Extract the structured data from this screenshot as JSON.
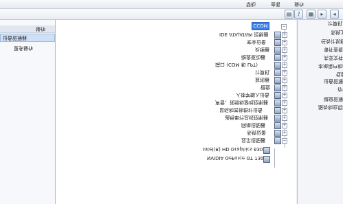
{
  "menu": [
    "帮助",
    "查看",
    "操作"
  ],
  "left_pane": {
    "header": "操作",
    "selected": "设备管理器",
    "sub": "更多操作"
  },
  "tree": {
    "root": "CCOM",
    "items": [
      {
        "label": "IDE ATA/ATAPI 控制器",
        "expanded": false
      },
      {
        "label": "安全设备",
        "expanded": false
      },
      {
        "label": "处理器",
        "expanded": false
      },
      {
        "label": "磁盘驱动器",
        "expanded": false
      },
      {
        "label": "端口 (COM 和 LPT)",
        "expanded": false
      },
      {
        "label": "计算机",
        "expanded": false
      },
      {
        "label": "监视器",
        "expanded": false
      },
      {
        "label": "键盘",
        "expanded": false
      },
      {
        "label": "人体学输入设备",
        "expanded": false
      },
      {
        "label": "声音、视频和游戏控制器",
        "expanded": false
      },
      {
        "label": "鼠标和其他指针设备",
        "expanded": false
      },
      {
        "label": "通用串行总线控制器",
        "expanded": false
      },
      {
        "label": "网络适配器",
        "expanded": false
      },
      {
        "label": "系统设备",
        "expanded": false
      },
      {
        "label": "显示适配器",
        "expanded": true
      }
    ],
    "children": [
      "Intel(R) HD Graphics 630",
      "NVIDIA GeForce GT 730"
    ]
  },
  "right_pane": {
    "items": [
      "计算机",
      "系统工具",
      "任务计划程序",
      "事件查看器",
      "共享文件夹",
      "本地用户和组",
      "性能",
      "设备管理器",
      "存储",
      "磁盘管理",
      "服务和应用程序"
    ]
  }
}
